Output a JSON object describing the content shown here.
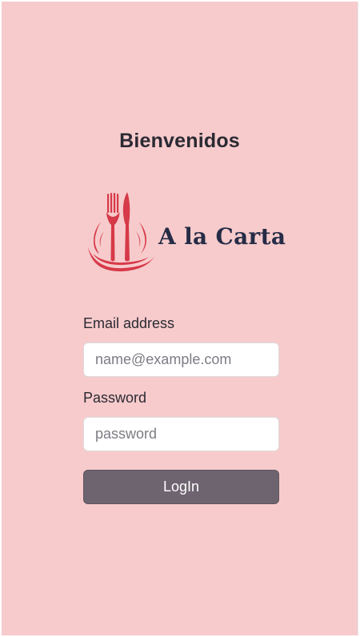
{
  "header": {
    "title": "Bienvenidos"
  },
  "logo": {
    "icon": "fork-knife-plate-icon",
    "text": "A la Carta"
  },
  "form": {
    "email": {
      "label": "Email address",
      "value": "",
      "placeholder": "name@example.com"
    },
    "password": {
      "label": "Password",
      "value": "",
      "placeholder": "password"
    },
    "submit_label": "LogIn"
  },
  "colors": {
    "background": "#f7cbcc",
    "logo_red": "#d63a48",
    "logo_text": "#262c46",
    "button": "#6e6470",
    "button_text": "#ffffff"
  }
}
